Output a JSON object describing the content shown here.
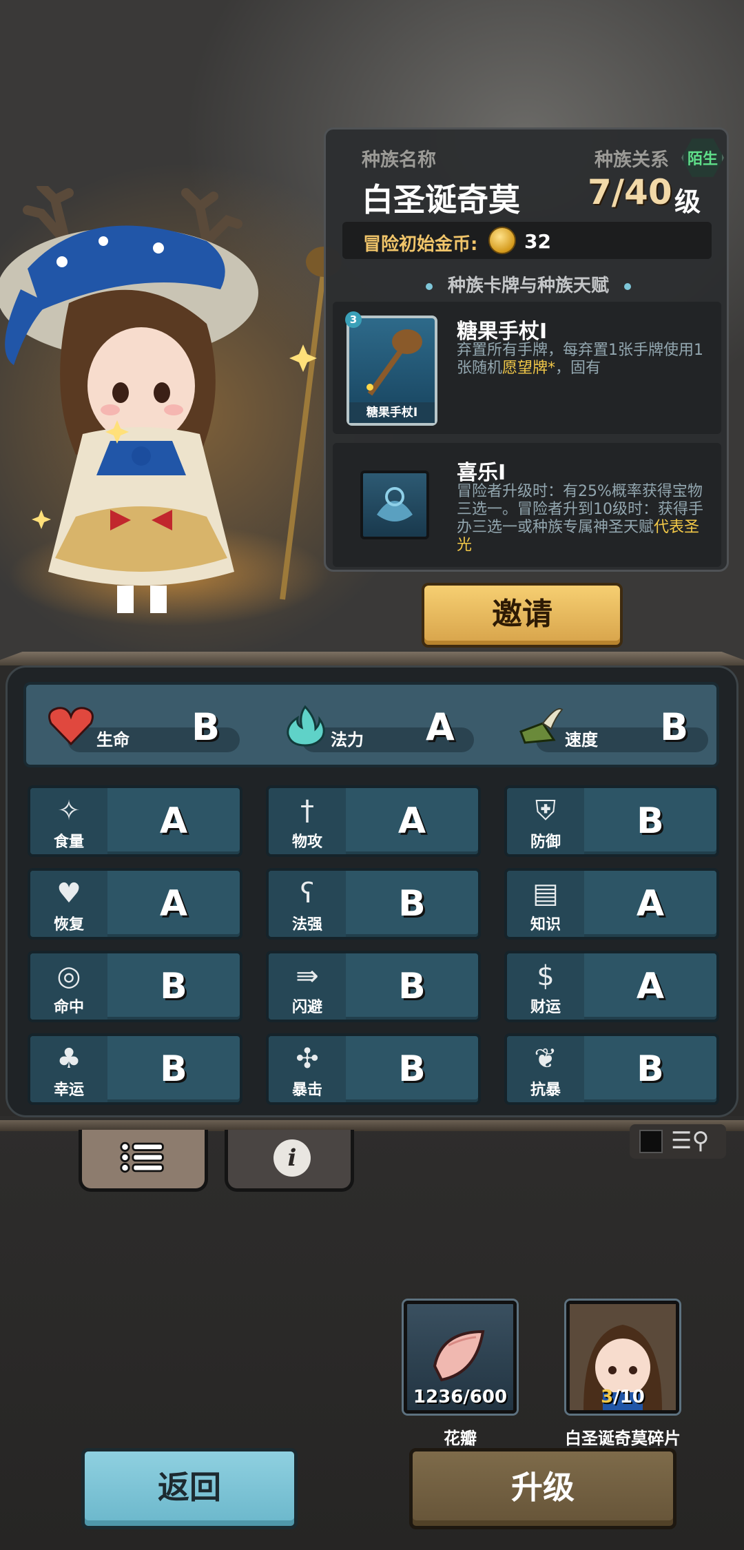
{
  "race": {
    "name_label": "种族名称",
    "relation_label": "种族关系",
    "relation_value": "陌生",
    "name": "白圣诞奇莫",
    "level": "7/40",
    "level_unit": "级",
    "gold_label": "冒险初始金币:",
    "gold_value": "32",
    "section_title": "种族卡牌与种族天赋"
  },
  "card": {
    "level": "3",
    "thumb_label": "糖果手杖I",
    "title": "糖果手杖I",
    "desc_1": "弃置所有手牌，每弃置1张手牌使用1张随机",
    "desc_hl": "愿望牌*",
    "desc_2": "，固有"
  },
  "talent": {
    "title": "喜乐I",
    "desc_1": "冒险者升级时：有25%概率获得宝物三选一。冒险者升到10级时：获得手办三选一或种族专属神圣天赋",
    "desc_hl": "代表圣光"
  },
  "invite_label": "邀请",
  "main_stats": [
    {
      "label": "生命",
      "grade": "B",
      "icon": "heart-icon"
    },
    {
      "label": "法力",
      "grade": "A",
      "icon": "flame-icon"
    },
    {
      "label": "速度",
      "grade": "B",
      "icon": "winged-boot-icon"
    }
  ],
  "stats": [
    {
      "label": "食量",
      "grade": "A",
      "icon": "stomach-icon"
    },
    {
      "label": "物攻",
      "grade": "A",
      "icon": "sword-icon"
    },
    {
      "label": "防御",
      "grade": "B",
      "icon": "armor-icon"
    },
    {
      "label": "恢复",
      "grade": "A",
      "icon": "heart-plus-icon"
    },
    {
      "label": "法强",
      "grade": "B",
      "icon": "staff-icon"
    },
    {
      "label": "知识",
      "grade": "A",
      "icon": "book-icon"
    },
    {
      "label": "命中",
      "grade": "B",
      "icon": "target-icon"
    },
    {
      "label": "闪避",
      "grade": "B",
      "icon": "dodge-icon"
    },
    {
      "label": "财运",
      "grade": "A",
      "icon": "money-bag-icon"
    },
    {
      "label": "幸运",
      "grade": "B",
      "icon": "clover-icon"
    },
    {
      "label": "暴击",
      "grade": "B",
      "icon": "crit-icon"
    },
    {
      "label": "抗暴",
      "grade": "B",
      "icon": "shield-flower-icon"
    }
  ],
  "tabs": {
    "info_glyph": "i"
  },
  "materials": {
    "petal": {
      "owned": "1236",
      "required": "600",
      "caption": "花瓣"
    },
    "shard": {
      "owned": "3",
      "required": "10",
      "caption": "白圣诞奇莫碎片"
    }
  },
  "buttons": {
    "back": "返回",
    "upgrade": "升级"
  }
}
